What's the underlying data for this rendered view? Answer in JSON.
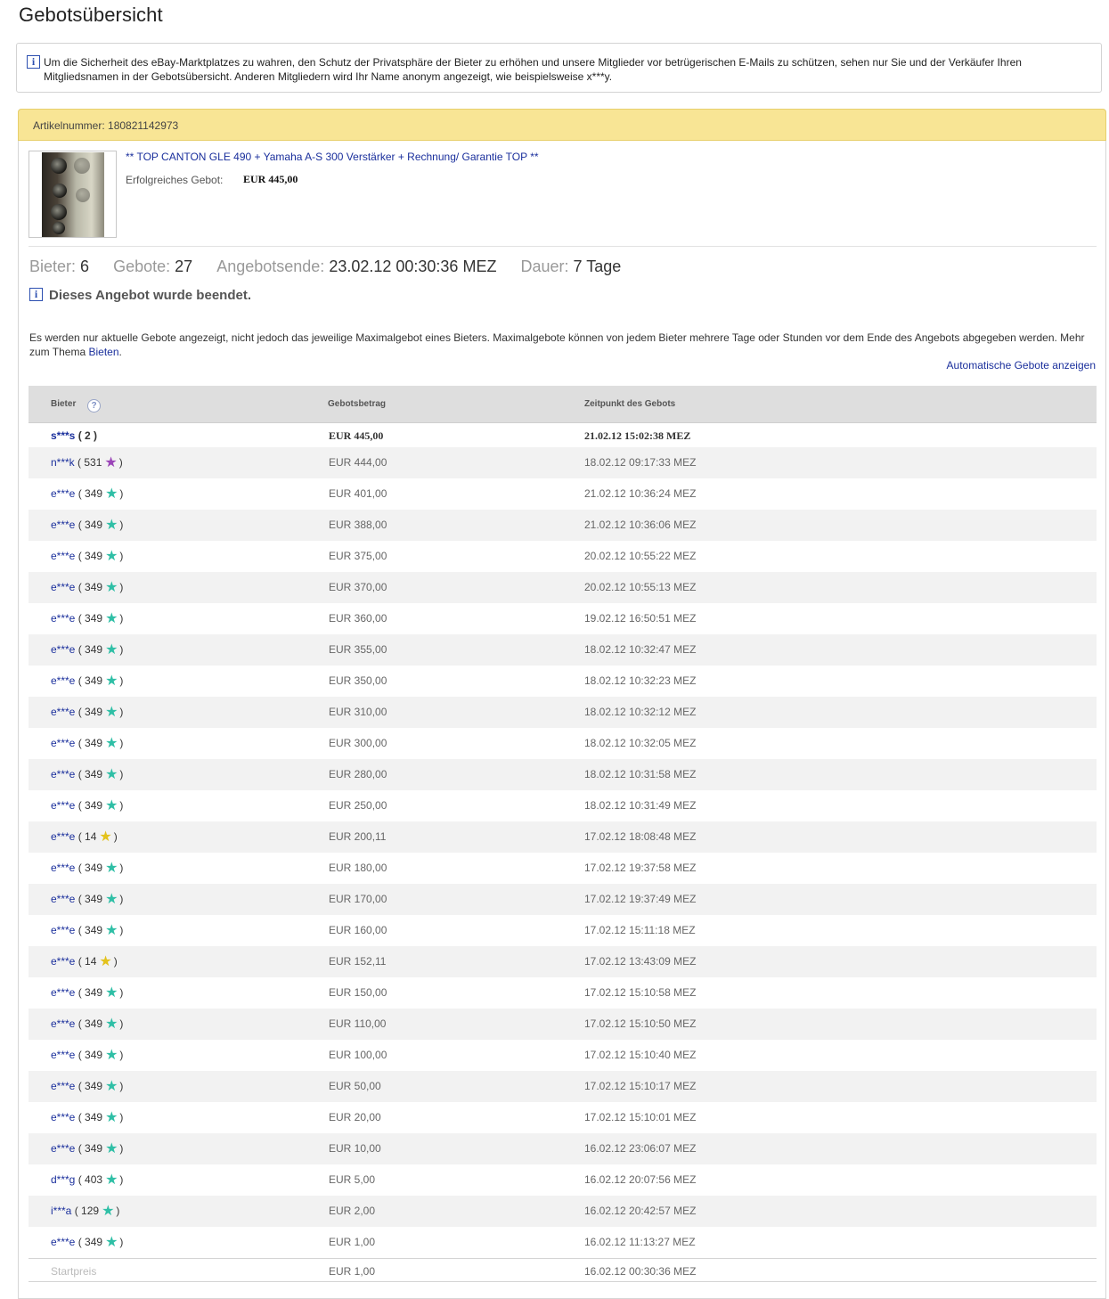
{
  "page": {
    "title": "Gebotsübersicht"
  },
  "notice": {
    "icon": "info-icon",
    "text": "Um die Sicherheit des eBay-Marktplatzes zu wahren, den Schutz der Privatsphäre der Bieter zu erhöhen und unsere Mitglieder vor betrügerischen E-Mails zu schützen, sehen nur Sie und der Verkäufer Ihren Mitgliedsnamen in der Gebotsübersicht. Anderen Mitgliedern wird Ihr Name anonym angezeigt, wie beispielsweise x***y."
  },
  "item": {
    "number_label": "Artikelnummer:",
    "number": "180821142973",
    "title": "** TOP CANTON GLE 490 + Yamaha A-S 300 Verstärker + Rechnung/ Garantie TOP **",
    "winning_bid_label": "Erfolgreiches Gebot:",
    "winning_bid_value": "EUR 445,00"
  },
  "stats": {
    "bidders_label": "Bieter:",
    "bidders_value": "6",
    "bids_label": "Gebote:",
    "bids_value": "27",
    "end_label": "Angebotsende:",
    "end_value": "23.02.12 00:30:36 MEZ",
    "duration_label": "Dauer:",
    "duration_value": "7 Tage"
  },
  "ended_text": "Dieses Angebot wurde beendet.",
  "description": {
    "text": "Es werden nur aktuelle Gebote angezeigt, nicht jedoch das jeweilige Maximalgebot eines Bieters. Maximalgebote können von jedem Bieter mehrere Tage oder Stunden vor dem Ende des Angebots abgegeben werden. Mehr zum Thema ",
    "link": "Bieten",
    "after": "."
  },
  "auto_bids_link": "Automatische Gebote anzeigen",
  "table": {
    "headers": {
      "bidder": "Bieter",
      "amount": "Gebotsbetrag",
      "time": "Zeitpunkt des Gebots"
    },
    "start_row": {
      "label": "Startpreis",
      "amount": "EUR 1,00",
      "time": "16.02.12 00:30:36 MEZ"
    },
    "rows": [
      {
        "name": "s***s",
        "score": "2",
        "star": "",
        "amount": "EUR 445,00",
        "time": "21.02.12 15:02:38 MEZ"
      },
      {
        "name": "n***k",
        "score": "531",
        "star": "purple",
        "amount": "EUR 444,00",
        "time": "18.02.12 09:17:33 MEZ"
      },
      {
        "name": "e***e",
        "score": "349",
        "star": "teal",
        "amount": "EUR 401,00",
        "time": "21.02.12 10:36:24 MEZ"
      },
      {
        "name": "e***e",
        "score": "349",
        "star": "teal",
        "amount": "EUR 388,00",
        "time": "21.02.12 10:36:06 MEZ"
      },
      {
        "name": "e***e",
        "score": "349",
        "star": "teal",
        "amount": "EUR 375,00",
        "time": "20.02.12 10:55:22 MEZ"
      },
      {
        "name": "e***e",
        "score": "349",
        "star": "teal",
        "amount": "EUR 370,00",
        "time": "20.02.12 10:55:13 MEZ"
      },
      {
        "name": "e***e",
        "score": "349",
        "star": "teal",
        "amount": "EUR 360,00",
        "time": "19.02.12 16:50:51 MEZ"
      },
      {
        "name": "e***e",
        "score": "349",
        "star": "teal",
        "amount": "EUR 355,00",
        "time": "18.02.12 10:32:47 MEZ"
      },
      {
        "name": "e***e",
        "score": "349",
        "star": "teal",
        "amount": "EUR 350,00",
        "time": "18.02.12 10:32:23 MEZ"
      },
      {
        "name": "e***e",
        "score": "349",
        "star": "teal",
        "amount": "EUR 310,00",
        "time": "18.02.12 10:32:12 MEZ"
      },
      {
        "name": "e***e",
        "score": "349",
        "star": "teal",
        "amount": "EUR 300,00",
        "time": "18.02.12 10:32:05 MEZ"
      },
      {
        "name": "e***e",
        "score": "349",
        "star": "teal",
        "amount": "EUR 280,00",
        "time": "18.02.12 10:31:58 MEZ"
      },
      {
        "name": "e***e",
        "score": "349",
        "star": "teal",
        "amount": "EUR 250,00",
        "time": "18.02.12 10:31:49 MEZ"
      },
      {
        "name": "e***e",
        "score": "14",
        "star": "yellow",
        "amount": "EUR 200,11",
        "time": "17.02.12 18:08:48 MEZ"
      },
      {
        "name": "e***e",
        "score": "349",
        "star": "teal",
        "amount": "EUR 180,00",
        "time": "17.02.12 19:37:58 MEZ"
      },
      {
        "name": "e***e",
        "score": "349",
        "star": "teal",
        "amount": "EUR 170,00",
        "time": "17.02.12 19:37:49 MEZ"
      },
      {
        "name": "e***e",
        "score": "349",
        "star": "teal",
        "amount": "EUR 160,00",
        "time": "17.02.12 15:11:18 MEZ"
      },
      {
        "name": "e***e",
        "score": "14",
        "star": "yellow",
        "amount": "EUR 152,11",
        "time": "17.02.12 13:43:09 MEZ"
      },
      {
        "name": "e***e",
        "score": "349",
        "star": "teal",
        "amount": "EUR 150,00",
        "time": "17.02.12 15:10:58 MEZ"
      },
      {
        "name": "e***e",
        "score": "349",
        "star": "teal",
        "amount": "EUR 110,00",
        "time": "17.02.12 15:10:50 MEZ"
      },
      {
        "name": "e***e",
        "score": "349",
        "star": "teal",
        "amount": "EUR 100,00",
        "time": "17.02.12 15:10:40 MEZ"
      },
      {
        "name": "e***e",
        "score": "349",
        "star": "teal",
        "amount": "EUR 50,00",
        "time": "17.02.12 15:10:17 MEZ"
      },
      {
        "name": "e***e",
        "score": "349",
        "star": "teal",
        "amount": "EUR 20,00",
        "time": "17.02.12 15:10:01 MEZ"
      },
      {
        "name": "e***e",
        "score": "349",
        "star": "teal",
        "amount": "EUR 10,00",
        "time": "16.02.12 23:06:07 MEZ"
      },
      {
        "name": "d***g",
        "score": "403",
        "star": "teal",
        "amount": "EUR 5,00",
        "time": "16.02.12 20:07:56 MEZ"
      },
      {
        "name": "i***a",
        "score": "129",
        "star": "teal",
        "amount": "EUR 2,00",
        "time": "16.02.12 20:42:57 MEZ"
      },
      {
        "name": "e***e",
        "score": "349",
        "star": "teal",
        "amount": "EUR 1,00",
        "time": "16.02.12 11:13:27 MEZ"
      }
    ]
  },
  "colors": {
    "link": "#1a2f9c",
    "header_band": "#f8e595",
    "row_alt": "#f2f2f2",
    "star_teal": "#2fbfa6",
    "star_purple": "#9b45b8",
    "star_yellow": "#e3c21c"
  }
}
